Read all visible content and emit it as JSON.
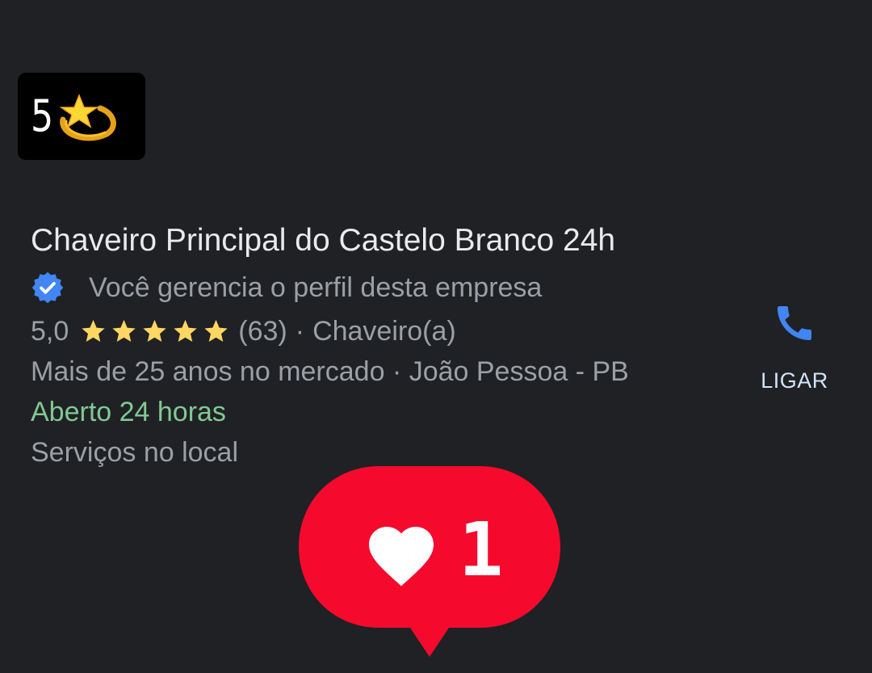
{
  "badge": {
    "number": "5",
    "emoji_icon": "dizzy-star-icon"
  },
  "business": {
    "name": "Chaveiro Principal do Castelo Branco 24h",
    "verified_text": "Você gerencia o perfil desta empresa",
    "rating": "5,0",
    "stars": 5,
    "review_count": "(63)",
    "category_sep": "·",
    "category": "Chaveiro(a)",
    "info": "Mais de 25 anos no mercado · João Pessoa - PB",
    "hours": "Aberto 24 horas",
    "services": "Serviços no local"
  },
  "call": {
    "label": "LIGAR",
    "icon": "phone-icon"
  },
  "like_bubble": {
    "count": "1",
    "icon": "heart-icon"
  },
  "colors": {
    "background": "#202124",
    "title": "#e8eaed",
    "secondary": "#9aa0a6",
    "open": "#81c995",
    "star": "#fdd663",
    "verified": "#4285f4",
    "call_icon": "#4285f4",
    "like_red": "#f50a2d"
  }
}
